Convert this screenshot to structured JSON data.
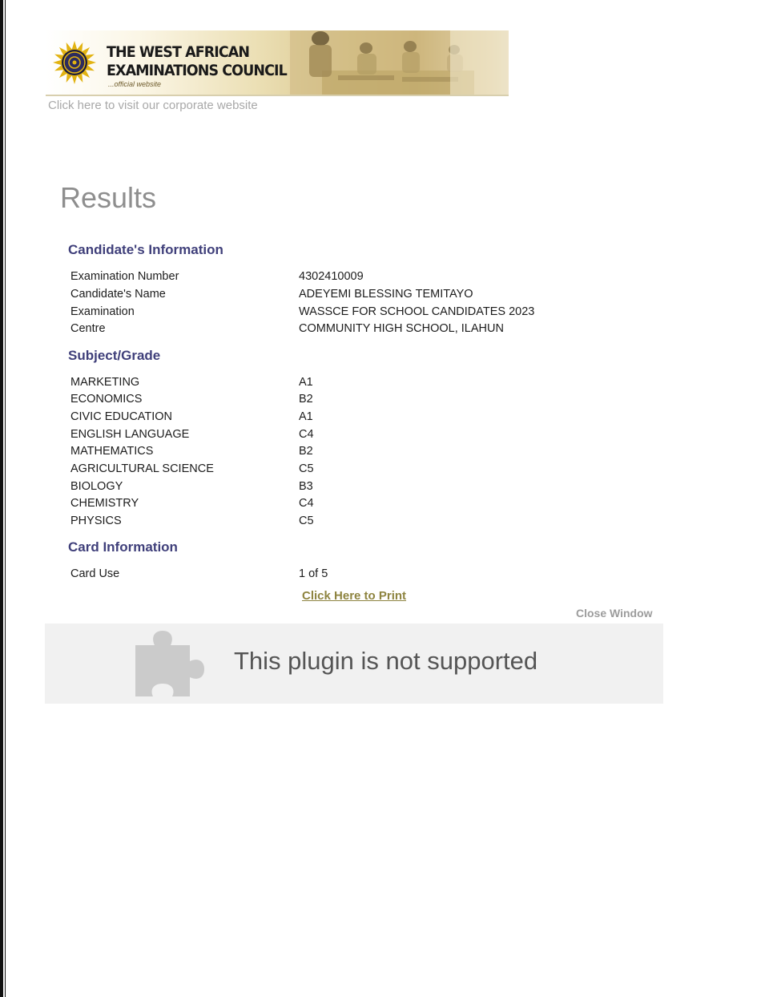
{
  "header": {
    "org_line1": "THE WEST AFRICAN",
    "org_line2": "EXAMINATIONS COUNCIL",
    "org_tagline": "...official website",
    "corporate_link": "Click here to visit our corporate website"
  },
  "page_title": "Results",
  "candidate_info": {
    "heading": "Candidate's Information",
    "rows": [
      {
        "label": "Examination Number",
        "value": "4302410009"
      },
      {
        "label": "Candidate's Name",
        "value": "ADEYEMI BLESSING TEMITAYO"
      },
      {
        "label": "Examination",
        "value": "WASSCE FOR SCHOOL CANDIDATES 2023"
      },
      {
        "label": "Centre",
        "value": "COMMUNITY HIGH SCHOOL, ILAHUN"
      }
    ]
  },
  "subjects": {
    "heading": "Subject/Grade",
    "rows": [
      {
        "subject": "MARKETING",
        "grade": "A1"
      },
      {
        "subject": "ECONOMICS",
        "grade": "B2"
      },
      {
        "subject": "CIVIC EDUCATION",
        "grade": "A1"
      },
      {
        "subject": "ENGLISH LANGUAGE",
        "grade": "C4"
      },
      {
        "subject": "MATHEMATICS",
        "grade": "B2"
      },
      {
        "subject": "AGRICULTURAL SCIENCE",
        "grade": "C5"
      },
      {
        "subject": "BIOLOGY",
        "grade": "B3"
      },
      {
        "subject": "CHEMISTRY",
        "grade": "C4"
      },
      {
        "subject": "PHYSICS",
        "grade": "C5"
      }
    ]
  },
  "card_info": {
    "heading": "Card Information",
    "label": "Card Use",
    "value": "1 of 5"
  },
  "actions": {
    "print_label": "Click Here to Print",
    "close_label": "Close Window"
  },
  "plugin": {
    "message": "This plugin is not supported",
    "icon": "puzzle-piece-icon"
  },
  "colors": {
    "heading": "#3f3f7a",
    "print_link": "#8e8440",
    "muted": "#9c9c9c"
  }
}
